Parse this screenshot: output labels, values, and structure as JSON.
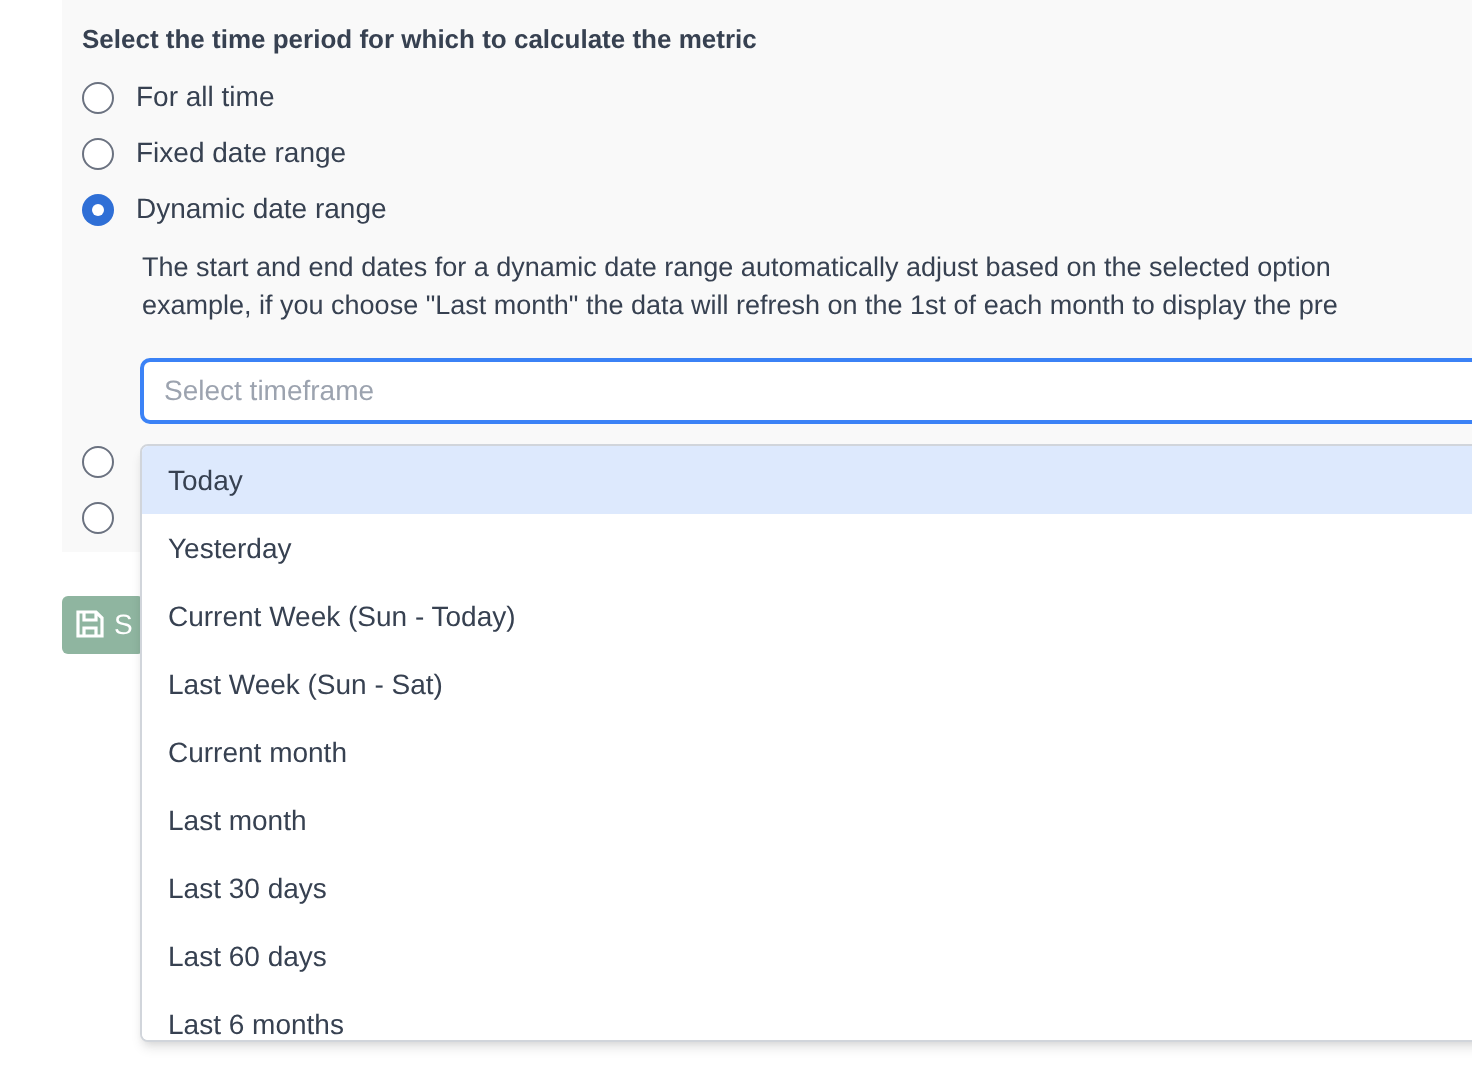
{
  "section": {
    "heading": "Select the time period for which to calculate the metric",
    "options": [
      {
        "label": "For all time",
        "selected": false
      },
      {
        "label": "Fixed date range",
        "selected": false
      },
      {
        "label": "Dynamic date range",
        "selected": true
      }
    ],
    "description": [
      "The start and end dates for a dynamic date range automatically adjust based on the selected option",
      "example, if you choose \"Last month\" the data will refresh on the 1st of each month to display the pre"
    ],
    "timeframe": {
      "placeholder": "Select timeframe"
    },
    "more_options": [
      {
        "selected": false
      },
      {
        "selected": false
      }
    ]
  },
  "save_button": {
    "label": "S",
    "disabled": true
  },
  "dropdown": [
    {
      "label": "Today",
      "selected": true
    },
    {
      "label": "Yesterday",
      "selected": false
    },
    {
      "label": "Current Week (Sun - Today)",
      "selected": false
    },
    {
      "label": "Last Week (Sun - Sat)",
      "selected": false
    },
    {
      "label": "Current month",
      "selected": false
    },
    {
      "label": "Last month",
      "selected": false
    },
    {
      "label": "Last 30 days",
      "selected": false
    },
    {
      "label": "Last 60 days",
      "selected": false
    },
    {
      "label": "Last 6 months",
      "selected": false
    }
  ]
}
